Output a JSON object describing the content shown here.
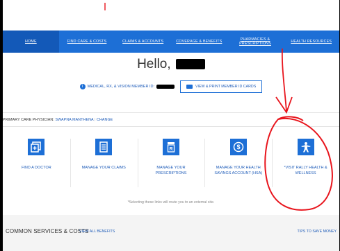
{
  "nav": {
    "items": [
      {
        "label": "HOME"
      },
      {
        "label": "FIND CARE & COSTS"
      },
      {
        "label": "CLAIMS & ACCOUNTS"
      },
      {
        "label": "COVERAGE & BENEFITS"
      },
      {
        "label": "PHARMACIES & PRESCRIPTIONS"
      },
      {
        "label": "HEALTH RESOURCES"
      }
    ]
  },
  "greeting": "Hello,",
  "member_id": {
    "label": "MEDICAL, RX, & VISION MEMBER ID:",
    "print_button": "VIEW & PRINT MEMBER ID CARDS"
  },
  "pcp": {
    "label": "PRIMARY CARE PHYSICIAN:",
    "name": "SWAPNA MANTHENA",
    "change": "CHANGE"
  },
  "tiles": [
    {
      "label": "FIND A DOCTOR",
      "icon": "find-doctor-icon"
    },
    {
      "label": "MANAGE YOUR CLAIMS",
      "icon": "claims-document-icon"
    },
    {
      "label": "MANAGE YOUR PRESCRIPTIONS",
      "icon": "prescription-icon"
    },
    {
      "label": "MANAGE YOUR HEALTH SAVINGS ACCOUNT (HSA)",
      "icon": "dollar-icon"
    },
    {
      "label": "*VISIT RALLY HEALTH & WELLNESS",
      "icon": "wellness-person-icon"
    }
  ],
  "note": "*Selecting these links will route you to an external site.",
  "bottom": {
    "title": "COMMON SERVICES & COSTS",
    "view_all": "VIEW ALL BENEFITS",
    "tips": "TIPS TO SAVE MONEY"
  },
  "colors": {
    "brand_blue": "#1d6fd6",
    "annotation_red": "#e8141c"
  }
}
